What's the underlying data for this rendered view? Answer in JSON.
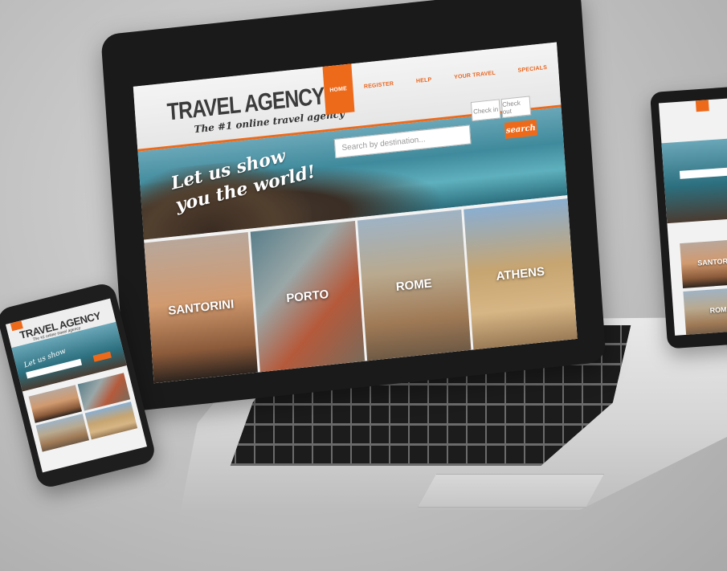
{
  "site": {
    "title": "TRAVEL AGENCY",
    "tagline": "The #1 online travel agency",
    "nav": [
      {
        "label": "HOME",
        "active": true
      },
      {
        "label": "REGISTER",
        "active": false
      },
      {
        "label": "HELP",
        "active": false
      },
      {
        "label": "YOUR TRAVEL",
        "active": false
      },
      {
        "label": "SPECIALS",
        "active": false
      }
    ],
    "hero_slogan_line1": "Let us show",
    "hero_slogan_line2": "you the world!",
    "search_placeholder": "Search by destination...",
    "check_in_label": "Check in",
    "check_out_label": "Check out",
    "search_button": "search",
    "destinations": [
      {
        "name": "SANTORINI"
      },
      {
        "name": "PORTO"
      },
      {
        "name": "ROME"
      },
      {
        "name": "ATHENS"
      }
    ],
    "accent_color": "#ee6a1b"
  },
  "devices": [
    "laptop",
    "phone",
    "tablet"
  ]
}
